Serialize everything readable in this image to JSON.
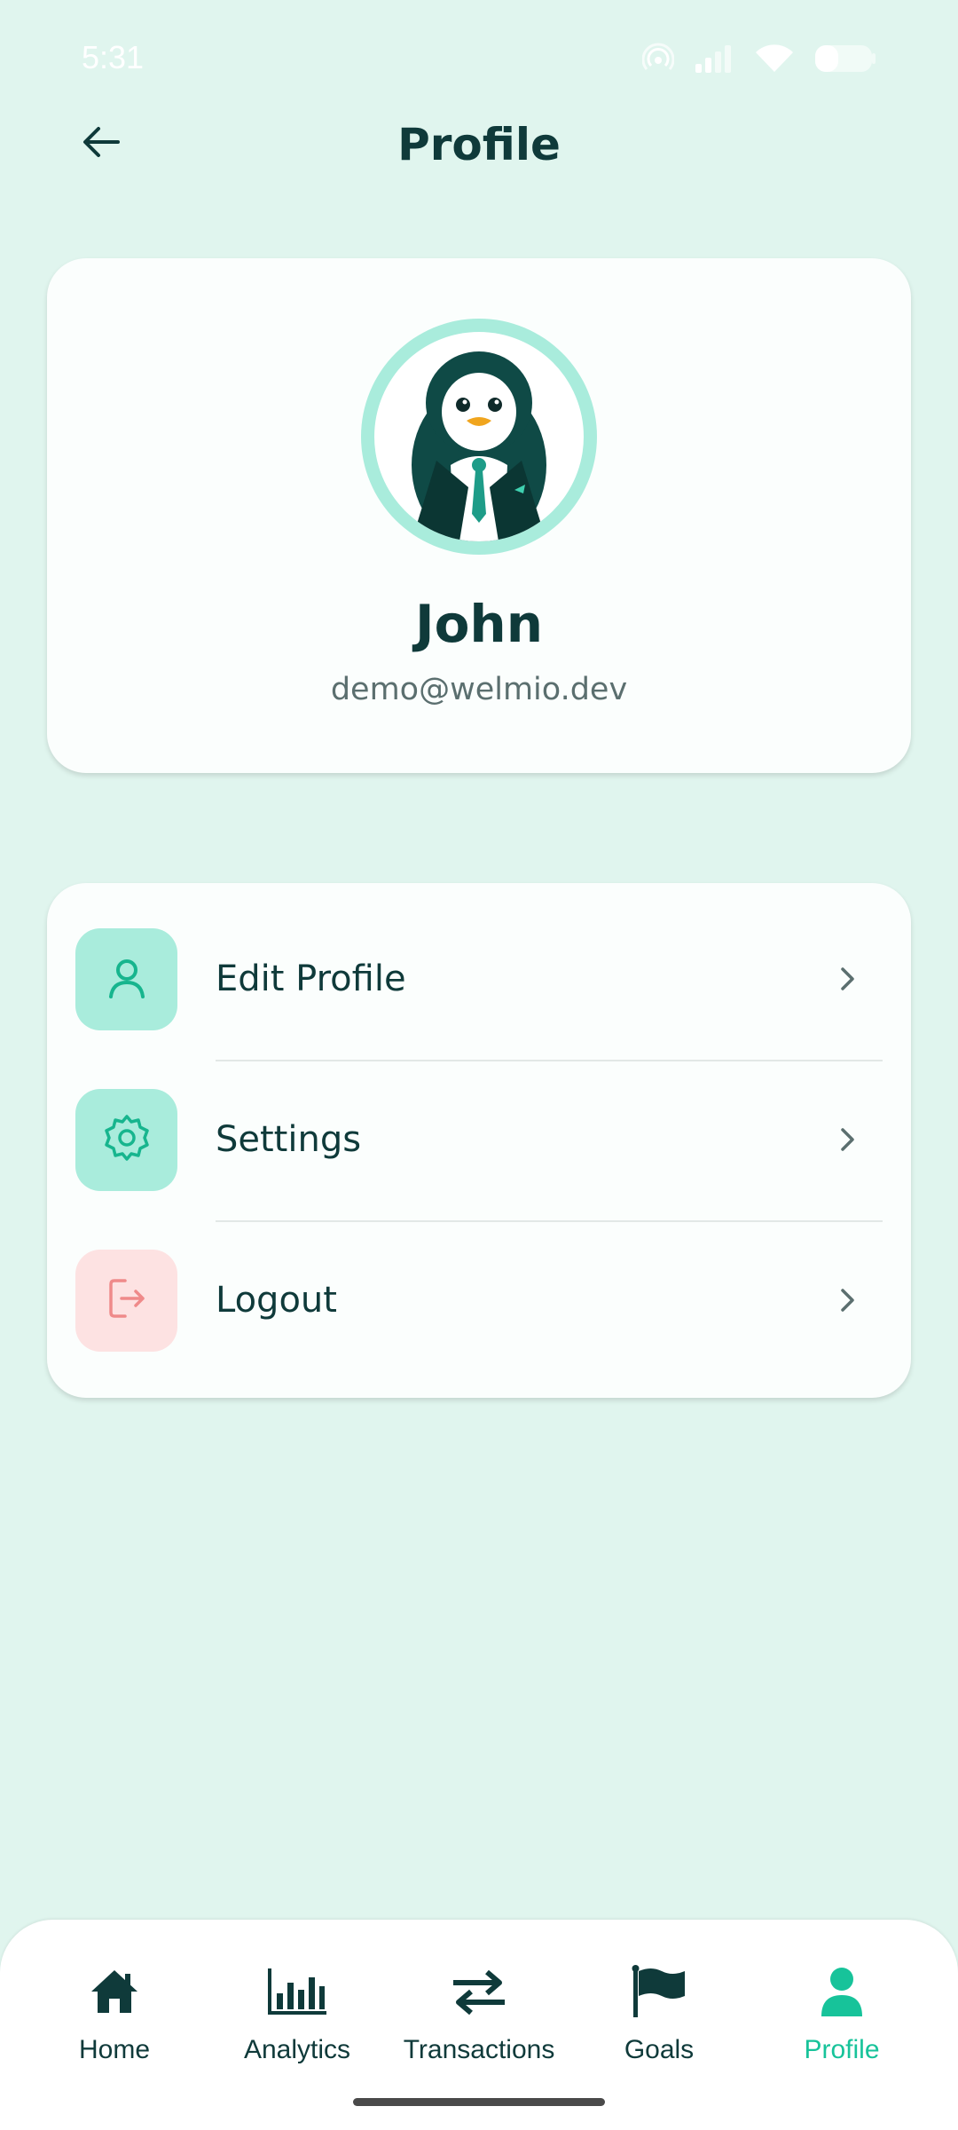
{
  "status_bar": {
    "time": "5:31",
    "icons": [
      "hotspot-icon",
      "signal-icon",
      "wifi-icon",
      "battery-icon"
    ]
  },
  "header": {
    "title": "Profile",
    "back_icon": "arrow-left-icon"
  },
  "profile": {
    "name": "John",
    "email": "demo@welmio.dev",
    "avatar": "penguin-in-suit-avatar"
  },
  "menu": {
    "items": [
      {
        "label": "Edit Profile",
        "icon": "user-icon",
        "icon_bg": "#a9ecdc",
        "icon_color": "#17b58e"
      },
      {
        "label": "Settings",
        "icon": "gear-icon",
        "icon_bg": "#a9ecdc",
        "icon_color": "#17b58e"
      },
      {
        "label": "Logout",
        "icon": "logout-icon",
        "icon_bg": "#fde2e2",
        "icon_color": "#ef8a8a"
      }
    ]
  },
  "bottom_nav": {
    "items": [
      {
        "label": "Home",
        "icon": "home-icon"
      },
      {
        "label": "Analytics",
        "icon": "bar-chart-icon"
      },
      {
        "label": "Transactions",
        "icon": "transfer-arrows-icon"
      },
      {
        "label": "Goals",
        "icon": "flag-icon"
      },
      {
        "label": "Profile",
        "icon": "user-filled-icon"
      }
    ],
    "active": "Profile"
  },
  "colors": {
    "background": "#e0f5ee",
    "accent": "#17c39a",
    "text_dark": "#0f3a3a",
    "logout_tint": "#ef8a8a"
  }
}
